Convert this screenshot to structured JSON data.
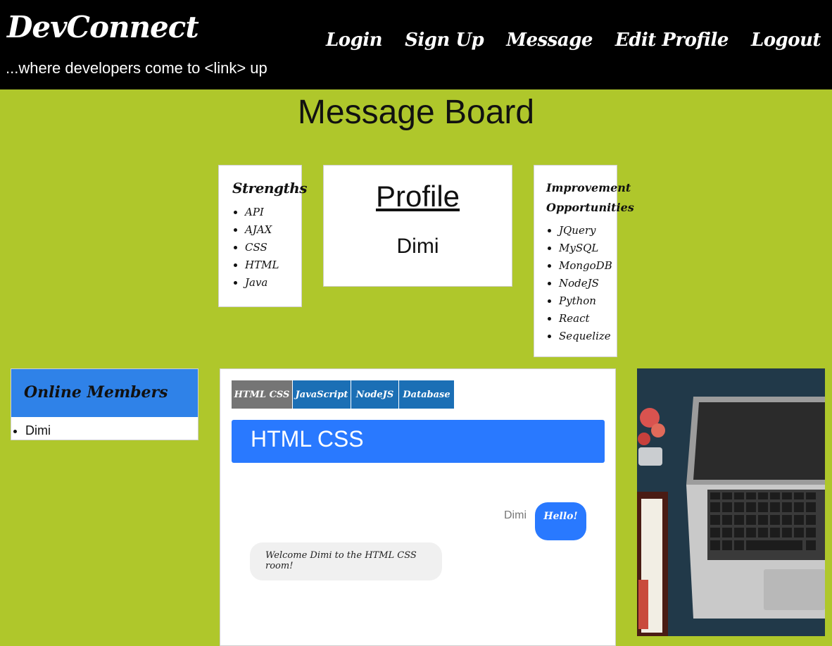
{
  "header": {
    "brand": "DevConnect",
    "tagline": "...where developers come to <link> up",
    "nav": [
      "Login",
      "Sign Up",
      "Message",
      "Edit Profile",
      "Logout"
    ]
  },
  "page": {
    "title": "Message Board"
  },
  "strengths": {
    "title": "Strengths",
    "items": [
      "API",
      "AJAX",
      "CSS",
      "HTML",
      "Java"
    ]
  },
  "profile": {
    "heading": "Profile",
    "name": "Dimi"
  },
  "improvement": {
    "title_line1": "Improvement",
    "title_line2": "Opportunities",
    "items": [
      "JQuery",
      "MySQL",
      "MongoDB",
      "NodeJS",
      "Python",
      "React",
      "Sequelize"
    ]
  },
  "online": {
    "title": "Online Members",
    "members": [
      "Dimi"
    ]
  },
  "chat": {
    "tabs": [
      "HTML CSS",
      "JavaScript",
      "NodeJS",
      "Database"
    ],
    "active_tab": "HTML CSS",
    "room_title": "HTML CSS",
    "messages": [
      {
        "sender": "Dimi",
        "text": "Hello!"
      },
      {
        "sender": "",
        "text": "Welcome Dimi to the HTML CSS room!"
      }
    ]
  },
  "colors": {
    "background": "#afc72b",
    "navbar": "#000000",
    "online_header": "#2f82e8",
    "tab": "#1b6fb5",
    "tab_active": "#757575",
    "room_header": "#2979ff"
  }
}
